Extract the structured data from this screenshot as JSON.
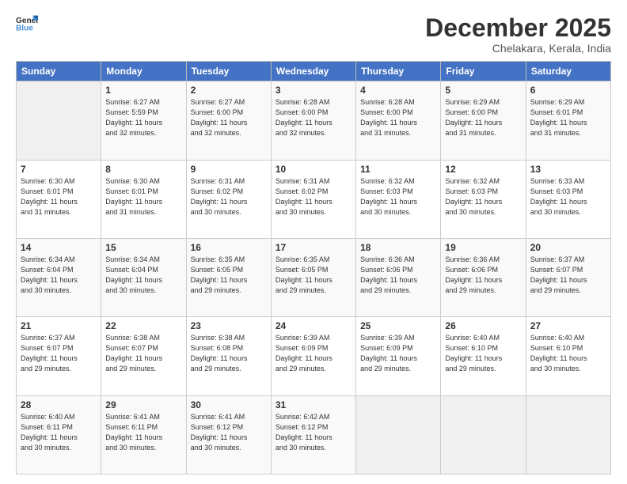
{
  "header": {
    "logo_general": "General",
    "logo_blue": "Blue",
    "month_title": "December 2025",
    "subtitle": "Chelakara, Kerala, India"
  },
  "days_of_week": [
    "Sunday",
    "Monday",
    "Tuesday",
    "Wednesday",
    "Thursday",
    "Friday",
    "Saturday"
  ],
  "weeks": [
    [
      {
        "day": "",
        "sunrise": "",
        "sunset": "",
        "daylight": ""
      },
      {
        "day": "1",
        "sunrise": "6:27 AM",
        "sunset": "5:59 PM",
        "daylight": "11 hours and 32 minutes."
      },
      {
        "day": "2",
        "sunrise": "6:27 AM",
        "sunset": "6:00 PM",
        "daylight": "11 hours and 32 minutes."
      },
      {
        "day": "3",
        "sunrise": "6:28 AM",
        "sunset": "6:00 PM",
        "daylight": "11 hours and 32 minutes."
      },
      {
        "day": "4",
        "sunrise": "6:28 AM",
        "sunset": "6:00 PM",
        "daylight": "11 hours and 31 minutes."
      },
      {
        "day": "5",
        "sunrise": "6:29 AM",
        "sunset": "6:00 PM",
        "daylight": "11 hours and 31 minutes."
      },
      {
        "day": "6",
        "sunrise": "6:29 AM",
        "sunset": "6:01 PM",
        "daylight": "11 hours and 31 minutes."
      }
    ],
    [
      {
        "day": "7",
        "sunrise": "6:30 AM",
        "sunset": "6:01 PM",
        "daylight": "11 hours and 31 minutes."
      },
      {
        "day": "8",
        "sunrise": "6:30 AM",
        "sunset": "6:01 PM",
        "daylight": "11 hours and 31 minutes."
      },
      {
        "day": "9",
        "sunrise": "6:31 AM",
        "sunset": "6:02 PM",
        "daylight": "11 hours and 30 minutes."
      },
      {
        "day": "10",
        "sunrise": "6:31 AM",
        "sunset": "6:02 PM",
        "daylight": "11 hours and 30 minutes."
      },
      {
        "day": "11",
        "sunrise": "6:32 AM",
        "sunset": "6:03 PM",
        "daylight": "11 hours and 30 minutes."
      },
      {
        "day": "12",
        "sunrise": "6:32 AM",
        "sunset": "6:03 PM",
        "daylight": "11 hours and 30 minutes."
      },
      {
        "day": "13",
        "sunrise": "6:33 AM",
        "sunset": "6:03 PM",
        "daylight": "11 hours and 30 minutes."
      }
    ],
    [
      {
        "day": "14",
        "sunrise": "6:34 AM",
        "sunset": "6:04 PM",
        "daylight": "11 hours and 30 minutes."
      },
      {
        "day": "15",
        "sunrise": "6:34 AM",
        "sunset": "6:04 PM",
        "daylight": "11 hours and 30 minutes."
      },
      {
        "day": "16",
        "sunrise": "6:35 AM",
        "sunset": "6:05 PM",
        "daylight": "11 hours and 29 minutes."
      },
      {
        "day": "17",
        "sunrise": "6:35 AM",
        "sunset": "6:05 PM",
        "daylight": "11 hours and 29 minutes."
      },
      {
        "day": "18",
        "sunrise": "6:36 AM",
        "sunset": "6:06 PM",
        "daylight": "11 hours and 29 minutes."
      },
      {
        "day": "19",
        "sunrise": "6:36 AM",
        "sunset": "6:06 PM",
        "daylight": "11 hours and 29 minutes."
      },
      {
        "day": "20",
        "sunrise": "6:37 AM",
        "sunset": "6:07 PM",
        "daylight": "11 hours and 29 minutes."
      }
    ],
    [
      {
        "day": "21",
        "sunrise": "6:37 AM",
        "sunset": "6:07 PM",
        "daylight": "11 hours and 29 minutes."
      },
      {
        "day": "22",
        "sunrise": "6:38 AM",
        "sunset": "6:07 PM",
        "daylight": "11 hours and 29 minutes."
      },
      {
        "day": "23",
        "sunrise": "6:38 AM",
        "sunset": "6:08 PM",
        "daylight": "11 hours and 29 minutes."
      },
      {
        "day": "24",
        "sunrise": "6:39 AM",
        "sunset": "6:09 PM",
        "daylight": "11 hours and 29 minutes."
      },
      {
        "day": "25",
        "sunrise": "6:39 AM",
        "sunset": "6:09 PM",
        "daylight": "11 hours and 29 minutes."
      },
      {
        "day": "26",
        "sunrise": "6:40 AM",
        "sunset": "6:10 PM",
        "daylight": "11 hours and 29 minutes."
      },
      {
        "day": "27",
        "sunrise": "6:40 AM",
        "sunset": "6:10 PM",
        "daylight": "11 hours and 30 minutes."
      }
    ],
    [
      {
        "day": "28",
        "sunrise": "6:40 AM",
        "sunset": "6:11 PM",
        "daylight": "11 hours and 30 minutes."
      },
      {
        "day": "29",
        "sunrise": "6:41 AM",
        "sunset": "6:11 PM",
        "daylight": "11 hours and 30 minutes."
      },
      {
        "day": "30",
        "sunrise": "6:41 AM",
        "sunset": "6:12 PM",
        "daylight": "11 hours and 30 minutes."
      },
      {
        "day": "31",
        "sunrise": "6:42 AM",
        "sunset": "6:12 PM",
        "daylight": "11 hours and 30 minutes."
      },
      {
        "day": "",
        "sunrise": "",
        "sunset": "",
        "daylight": ""
      },
      {
        "day": "",
        "sunrise": "",
        "sunset": "",
        "daylight": ""
      },
      {
        "day": "",
        "sunrise": "",
        "sunset": "",
        "daylight": ""
      }
    ]
  ],
  "labels": {
    "sunrise_prefix": "Sunrise: ",
    "sunset_prefix": "Sunset: ",
    "daylight_prefix": "Daylight: "
  }
}
